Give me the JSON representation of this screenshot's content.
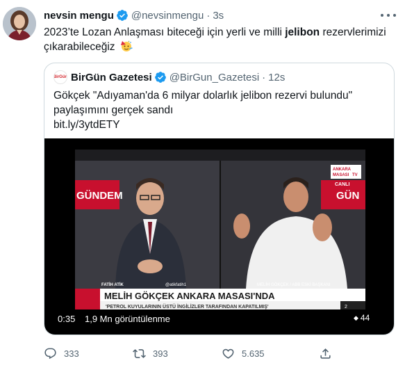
{
  "tweet": {
    "author_name": "nevsin mengu",
    "author_handle": "@nevsinmengu",
    "separator": "·",
    "time": "3s",
    "text_part1": "2023’te Lozan Anlaşması biteceği için yerli ve milli ",
    "text_bold": "jelibon",
    "text_part2": " rezervlerimizi çıkarabileceğiz",
    "emoji_name": "partying-face-emoji"
  },
  "quote": {
    "author_name": "BirGün Gazetesi",
    "author_handle": "@BirGun_Gazetesi",
    "separator": "·",
    "time": "12s",
    "avatar_text": "BirGün",
    "line1": "Gökçek \"Adıyaman'da 6 milyar dolarlık jelibon rezervi bulundu\"",
    "line2": "paylaşımını gerçek sandı",
    "link": "bit.ly/3ytdETY",
    "video": {
      "time": "0:35",
      "views": "1,9 Mn görüntülenme",
      "badge_count": "44",
      "channel_logo_line1": "ANKARA",
      "channel_logo_line2": "MASASI",
      "channel_logo_line3": "TV",
      "live": "CANLI",
      "left_banner": "GÜNDEM",
      "right_banner": "GÜN",
      "left_caption": "FATİH ATİK",
      "left_caption_handle": "@atikfatih1",
      "right_caption": "MELİH GÖKÇEK / ABB ESKİ BAŞKANI",
      "headline": "MELİH GÖKÇEK ANKARA MASASI'NDA",
      "subheadline": "'PETROL KUYULARININ ÜSTÜ İNGİLİZLER TARAFINDAN KAPATILMIŞ'",
      "corner_number": "2"
    }
  },
  "actions": {
    "replies": "333",
    "retweets": "393",
    "likes": "5.635"
  },
  "colors": {
    "verified_blue": "#1d9bf0",
    "secondary_text": "#536471",
    "border": "#cfd9de",
    "tv_red": "#c8102e"
  }
}
